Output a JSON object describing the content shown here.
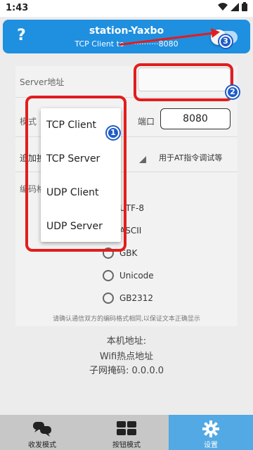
{
  "status_bar": {
    "time": "1:43"
  },
  "top_bar": {
    "help_label": "?",
    "title": "station-Yaxbo",
    "subtitle": "TCP Client to ·············8080",
    "toggle_on": false
  },
  "form": {
    "server_label": "Server地址",
    "server_value": "",
    "mode_label": "模式",
    "port_label": "端口",
    "port_value": "8080",
    "append_label": "追加换",
    "at_hint": "用于AT指令调试等",
    "encoding_label": "编码格",
    "encodings": [
      "UTF-8",
      "ASCII",
      "GBK",
      "Unicode",
      "GB2312"
    ],
    "notice": "请确认通信双方的编码格式相同,以保证文本正确显示"
  },
  "mode_popup": {
    "options": [
      "TCP Client",
      "TCP Server",
      "UDP Client",
      "UDP Server"
    ]
  },
  "network_info": {
    "local_address_label": "本机地址:",
    "hotspot_label": "Wifi热点地址",
    "subnet_label": "子网掩码:",
    "subnet_value": "0.0.0.0"
  },
  "annotations": {
    "badge1": "1",
    "badge2": "2",
    "badge3": "3",
    "accent_red": "#e21d1d",
    "badge_blue": "#1f5cc8"
  },
  "bottom_nav": {
    "items": [
      {
        "label": "收发模式",
        "icon": "chat-icon"
      },
      {
        "label": "按钮模式",
        "icon": "grid-icon"
      },
      {
        "label": "设置",
        "icon": "gear-icon"
      }
    ],
    "active_index": 2
  },
  "colors": {
    "primary": "#1f8fe0",
    "nav_active": "#52a9e3"
  }
}
